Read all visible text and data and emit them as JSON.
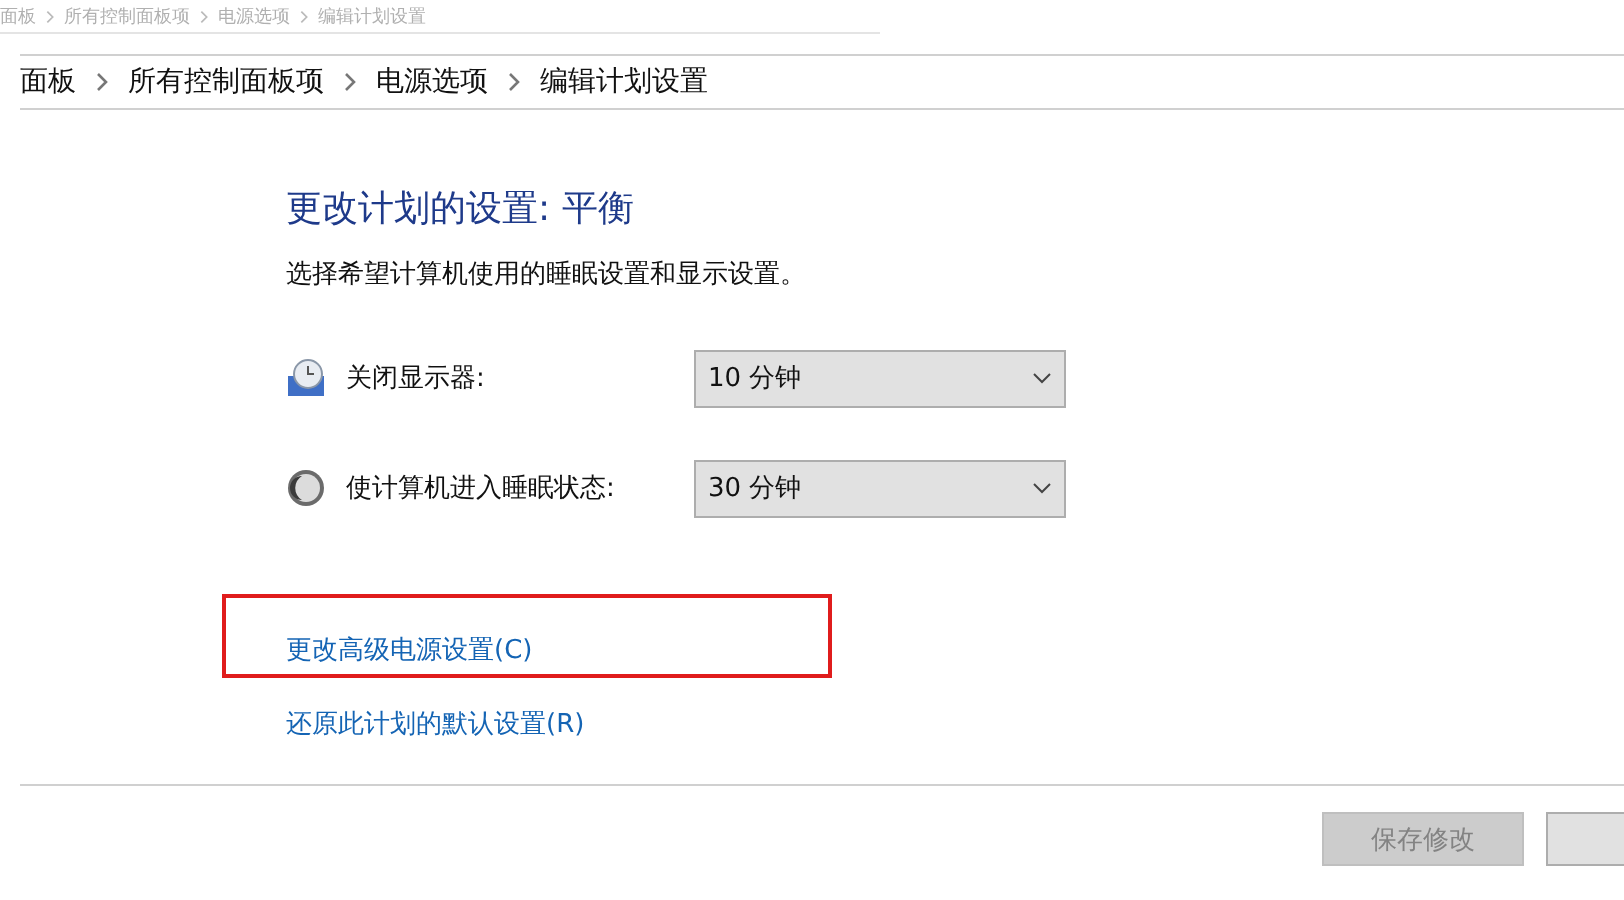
{
  "faded_breadcrumb": [
    "面板",
    "所有控制面板项",
    "电源选项",
    "编辑计划设置"
  ],
  "breadcrumb": [
    "面板",
    "所有控制面板项",
    "电源选项",
    "编辑计划设置"
  ],
  "title": "更改计划的设置: 平衡",
  "subtitle": "选择希望计算机使用的睡眠设置和显示设置。",
  "settings": [
    {
      "kind": "display",
      "label": "关闭显示器:",
      "value": "10 分钟"
    },
    {
      "kind": "sleep",
      "label": "使计算机进入睡眠状态:",
      "value": "30 分钟"
    }
  ],
  "links": [
    {
      "text": "更改高级电源设置(C)",
      "highlighted": true
    },
    {
      "text": "还原此计划的默认设置(R)",
      "highlighted": false
    }
  ],
  "buttons": [
    {
      "label": "保存修改",
      "disabled": true
    },
    {
      "disabled": false
    }
  ]
}
